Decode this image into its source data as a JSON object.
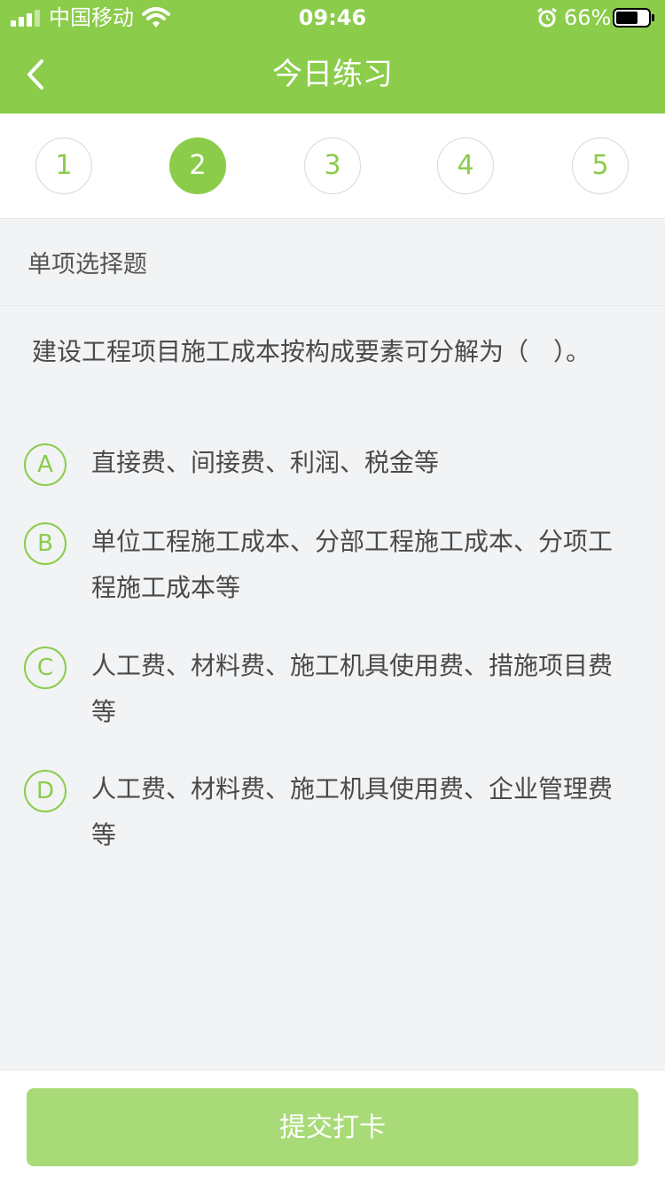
{
  "status_bar": {
    "carrier": "中国移动",
    "time": "09:46",
    "battery_percent": "66%",
    "icons": [
      "signal-icon",
      "wifi-icon",
      "alarm-icon",
      "battery-icon"
    ]
  },
  "nav": {
    "title": "今日练习",
    "back_icon": "chevron-left-icon"
  },
  "steps": [
    {
      "label": "1",
      "active": false
    },
    {
      "label": "2",
      "active": true
    },
    {
      "label": "3",
      "active": false
    },
    {
      "label": "4",
      "active": false
    },
    {
      "label": "5",
      "active": false
    }
  ],
  "question": {
    "type": "单项选择题",
    "text": "建设工程项目施工成本按构成要素可分解为（　）。",
    "options": [
      {
        "letter": "A",
        "text": "直接费、间接费、利润、税金等"
      },
      {
        "letter": "B",
        "text": "单位工程施工成本、分部工程施工成本、分项工程施工成本等"
      },
      {
        "letter": "C",
        "text": "人工费、材料费、施工机具使用费、措施项目费等"
      },
      {
        "letter": "D",
        "text": "人工费、材料费、施工机具使用费、企业管理费等"
      }
    ]
  },
  "footer": {
    "submit_label": "提交打卡"
  },
  "colors": {
    "brand_green": "#8bcc4b",
    "button_green_disabled": "#a8db78",
    "background": "#f1f3f5"
  }
}
